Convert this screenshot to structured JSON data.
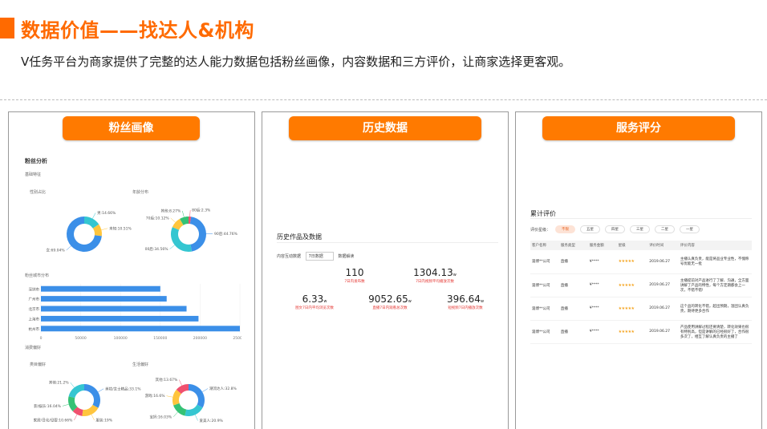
{
  "header": {
    "title": "数据价值——找达人&机构",
    "subtitle": "V任务平台为商家提供了完整的达人能力数据包括粉丝画像，内容数据和三方评价，让商家选择更客观。"
  },
  "panels": {
    "fans": {
      "label": "粉丝画像",
      "section_title": "粉丝分析",
      "basic_label": "基础特征",
      "gender_label": "性别占比",
      "age_label": "年龄分布",
      "gender_slices": [
        {
          "label": "男:14.66%",
          "value": 14.66,
          "color": "#34c6d1"
        },
        {
          "label": "未知:10.51%",
          "value": 10.51,
          "color": "#ffc53d"
        },
        {
          "label": "女:69.04%",
          "value": 69.04,
          "color": "#3b8fe8"
        }
      ],
      "age_slices": [
        {
          "label": "80后:2.3%",
          "value": 2.3,
          "color": "#f0506e"
        },
        {
          "label": "90后:44.76%",
          "value": 44.76,
          "color": "#3b8fe8"
        },
        {
          "label": "00后:34.56%",
          "value": 34.56,
          "color": "#34c6d1"
        },
        {
          "label": "70后:10.12%",
          "value": 10.12,
          "color": "#ffc53d"
        },
        {
          "label": "其他:8.27%",
          "value": 8.27,
          "color": "#35c275"
        }
      ],
      "city_label": "粉丝城市分布",
      "city_categories": [
        "深圳市",
        "广州市",
        "北京市",
        "上海市",
        "杭州市"
      ],
      "city_values": [
        150000,
        158000,
        183000,
        198000,
        250000
      ],
      "city_axis_ticks": [
        "0",
        "50000",
        "100000",
        "150000",
        "200000",
        "250000"
      ],
      "consume_label": "消费偏好",
      "shop_label": "类目偏好",
      "life_label": "生活偏好",
      "shop_slices": [
        {
          "label": "美妆/女士精品:33.1%",
          "value": 33.1,
          "color": "#3b8fe8"
        },
        {
          "label": "服装:19%",
          "value": 19.0,
          "color": "#ffc53d"
        },
        {
          "label": "家居/日化/母婴:10.66%",
          "value": 10.66,
          "color": "#f0506e"
        },
        {
          "label": "影/娱乐:16.04%",
          "value": 16.04,
          "color": "#35c275"
        },
        {
          "label": "其他:21.2%",
          "value": 21.2,
          "color": "#34c6d1"
        }
      ],
      "life_slices": [
        {
          "label": "潮流达人:32.8%",
          "value": 32.8,
          "color": "#3b8fe8"
        },
        {
          "label": "爱美人:20.9%",
          "value": 20.9,
          "color": "#34c6d1"
        },
        {
          "label": "宝妈:16.03%",
          "value": 16.03,
          "color": "#35c275"
        },
        {
          "label": "游戏:16.6%",
          "value": 16.6,
          "color": "#ffc53d"
        },
        {
          "label": "其他:13.67%",
          "value": 13.67,
          "color": "#f0506e"
        }
      ]
    },
    "history": {
      "label": "历史数据",
      "section_title": "历史作品及数据",
      "filter_label": "内容互动数据",
      "filter_value": "7日数据",
      "filter_hint": "数据解读",
      "stats": [
        {
          "value": "110",
          "unit": "",
          "label": "7日内发布数"
        },
        {
          "value": "1304.13",
          "unit": "w",
          "label": "7日内视频平均播放次数"
        },
        {
          "value": "6.33",
          "unit": "w",
          "label": "图文7日内平均浏览次数"
        },
        {
          "value": "9052.65",
          "unit": "w",
          "label": "直播7日内观看总次数"
        },
        {
          "value": "396.64",
          "unit": "w",
          "label": "短视频7日内播放次数"
        }
      ]
    },
    "service": {
      "label": "服务评分",
      "section_title": "累计评价",
      "filter_label": "评价星级：",
      "filter_chips": [
        "不限",
        "五星",
        "四星",
        "三星",
        "二星",
        "一星"
      ],
      "columns": [
        "客户名称",
        "服务类型",
        "服务金额",
        "星级",
        "评价时间",
        "评价内容"
      ],
      "rows": [
        [
          "淄博**公司",
          "直播",
          "¥****",
          "★★★★★",
          "2019.06.27",
          "主播认真负责，能是将品业专业性，不愧称号优能无一批"
        ],
        [
          "淄博**公司",
          "直播",
          "¥****",
          "★★★★★",
          "2019.06.27",
          "主播提前对产品进行了了解、沟通，全方面讲解了产品的特性，每个方定期都会上一次，不错不错!"
        ],
        [
          "淄博**公司",
          "直播",
          "¥****",
          "★★★★★",
          "2019.06.27",
          "这个品的转化不错，超出预期，温团认真负责，期待更多合作"
        ],
        [
          "淄博**公司",
          "直播",
          "¥****",
          "★★★★★",
          "2019.06.27",
          "产品使用讲解过程还要清楚，转化效果也很有特别高，但是讲解的已经很好了，合作很多次了，相互了解认真负责的主播了"
        ]
      ]
    }
  }
}
